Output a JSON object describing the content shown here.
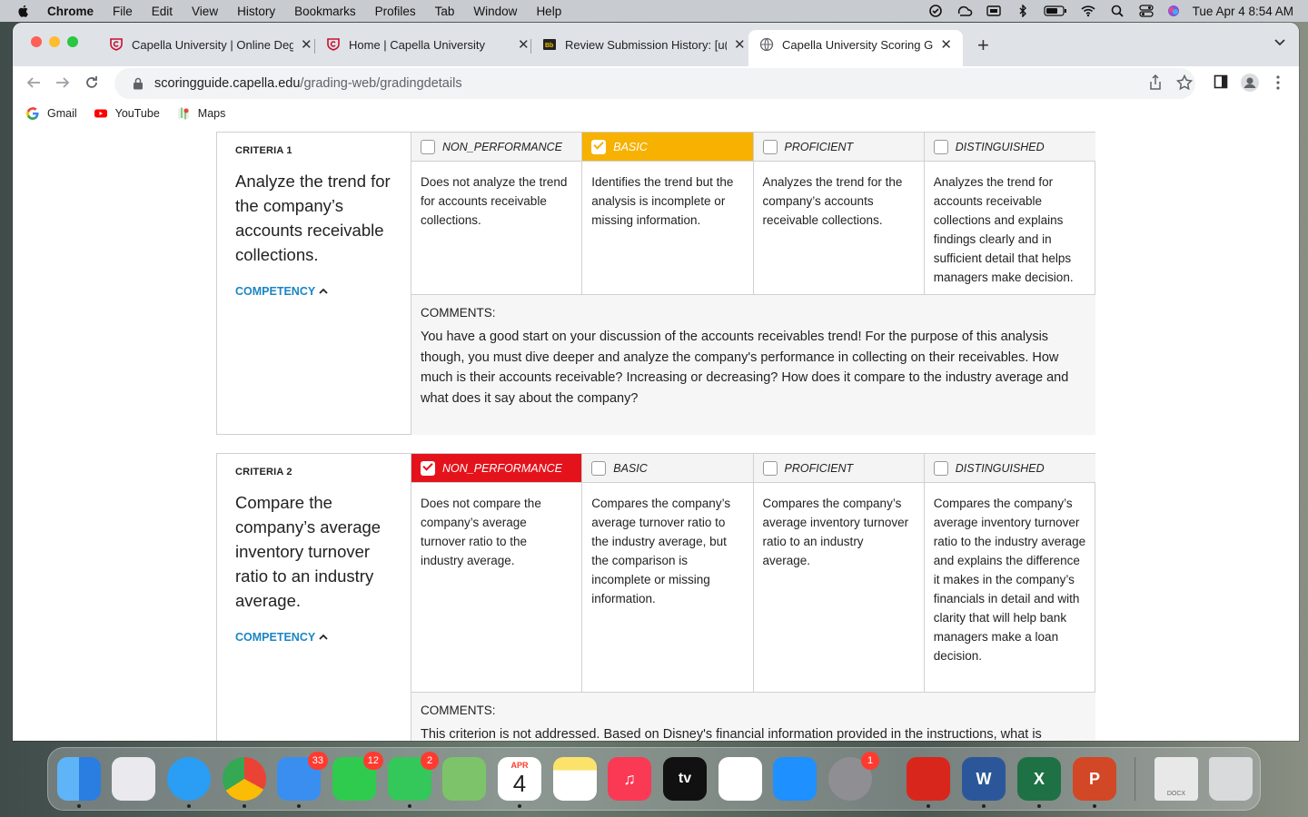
{
  "menubar": {
    "app": "Chrome",
    "items": [
      "File",
      "Edit",
      "View",
      "History",
      "Bookmarks",
      "Profiles",
      "Tab",
      "Window",
      "Help"
    ],
    "clock": "Tue Apr 4  8:54 AM"
  },
  "tabs": [
    {
      "title": "Capella University | Online Degr",
      "icon": "capella-shield-icon",
      "active": false
    },
    {
      "title": "Home | Capella University",
      "icon": "capella-shield-icon",
      "active": false
    },
    {
      "title": "Review Submission History: [u(",
      "icon": "blackboard-icon",
      "active": false
    },
    {
      "title": "Capella University Scoring Guid",
      "icon": "globe-icon",
      "active": true
    }
  ],
  "address": {
    "host": "scoringguide.capella.edu",
    "path": "/grading-web/gradingdetails"
  },
  "bookmarks": [
    {
      "label": "Gmail",
      "icon": "google-icon"
    },
    {
      "label": "YouTube",
      "icon": "youtube-icon"
    },
    {
      "label": "Maps",
      "icon": "maps-icon"
    }
  ],
  "criteria": [
    {
      "label": "CRITERIA 1",
      "text": "Analyze the trend for the company’s accounts receivable collections.",
      "competency": "COMPETENCY",
      "levels": [
        {
          "name": "NON_PERFORMANCE",
          "selected": false,
          "desc": "Does not analyze the trend for accounts receivable collections."
        },
        {
          "name": "BASIC",
          "selected": true,
          "desc": "Identifies the trend but the analysis is incomplete or missing information."
        },
        {
          "name": "PROFICIENT",
          "selected": false,
          "desc": "Analyzes the trend for the company’s accounts receivable collections."
        },
        {
          "name": "DISTINGUISHED",
          "selected": false,
          "desc": "Analyzes the trend for accounts receivable collections and explains findings clearly and in sufficient detail that helps managers make decision."
        }
      ],
      "comments_label": "COMMENTS:",
      "comment": "You have a good start on your discussion of the accounts receivables trend! For the purpose of this analysis though, you must dive deeper and analyze the company's performance in collecting on their receivables. How much is their accounts receivable? Increasing or decreasing? How does it compare to the industry average and what does it say about the company?"
    },
    {
      "label": "CRITERIA 2",
      "text": "Compare the company’s average inventory turnover ratio to an industry average.",
      "competency": "COMPETENCY",
      "levels": [
        {
          "name": "NON_PERFORMANCE",
          "selected": true,
          "desc": "Does not compare the company’s average turnover ratio to the industry average."
        },
        {
          "name": "BASIC",
          "selected": false,
          "desc": "Compares the company’s average turnover ratio to the industry average, but the comparison is incomplete or missing information."
        },
        {
          "name": "PROFICIENT",
          "selected": false,
          "desc": "Compares the company’s average inventory turnover ratio to an industry average."
        },
        {
          "name": "DISTINGUISHED",
          "selected": false,
          "desc": "Compares the company’s average inventory turnover ratio to the industry average and explains the difference it makes in the company’s financials in detail and with clarity that will help bank managers make a loan decision."
        }
      ],
      "comments_label": "COMMENTS:",
      "comment": "This criterion is not addressed. Based on Disney's financial information provided in the instructions, what is"
    }
  ],
  "dock": {
    "apps": [
      {
        "name": "Finder",
        "color": "#3b8fe8"
      },
      {
        "name": "Launchpad",
        "color": "#e9e9ee"
      },
      {
        "name": "Safari",
        "color": "#2a9df4"
      },
      {
        "name": "Chrome",
        "color": "#ffffff"
      },
      {
        "name": "Mail",
        "color": "#3a8ef0",
        "badge": "33"
      },
      {
        "name": "FaceTime",
        "color": "#2fcb4f",
        "badge": "12"
      },
      {
        "name": "Messages",
        "color": "#34c759",
        "badge": "2"
      },
      {
        "name": "Maps",
        "color": "#7cc36a"
      },
      {
        "name": "Calendar",
        "color": "#ffffff",
        "month": "APR",
        "day": "4"
      },
      {
        "name": "Notes",
        "color": "#fbe36b"
      },
      {
        "name": "Music",
        "color": "#fa3a55"
      },
      {
        "name": "TV",
        "color": "#111111",
        "label": "tv"
      },
      {
        "name": "News",
        "color": "#ffffff"
      },
      {
        "name": "App Store",
        "color": "#1e90ff"
      },
      {
        "name": "System Preferences",
        "color": "#8e8e93",
        "badge": "1"
      },
      {
        "name": "Acrobat",
        "color": "#d9261c"
      },
      {
        "name": "Word",
        "color": "#2b579a",
        "label": "W"
      },
      {
        "name": "Excel",
        "color": "#1e7145",
        "label": "X"
      },
      {
        "name": "PowerPoint",
        "color": "#d24726",
        "label": "P"
      },
      {
        "name": "Document",
        "color": "#e8e8e8",
        "label": "DOCX"
      },
      {
        "name": "Trash",
        "color": "#d8dadc"
      }
    ]
  }
}
